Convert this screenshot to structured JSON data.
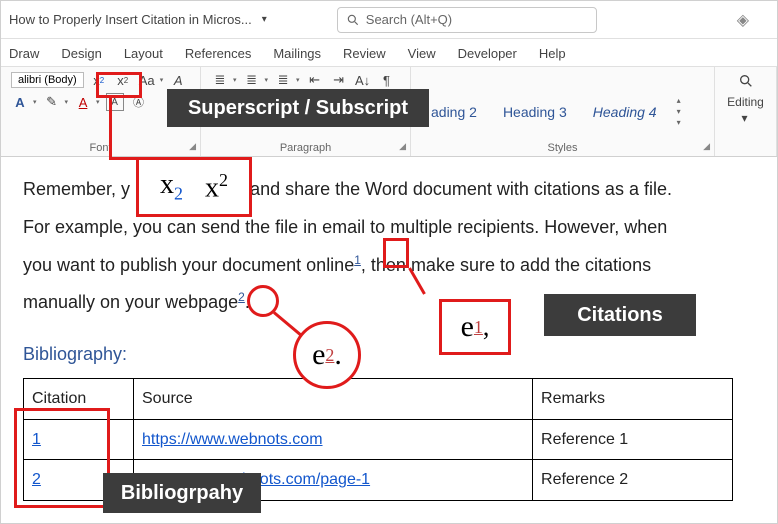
{
  "title": "How to Properly Insert Citation in Micros...",
  "search_placeholder": "Search (Alt+Q)",
  "tabs": [
    "Draw",
    "Design",
    "Layout",
    "References",
    "Mailings",
    "Review",
    "View",
    "Developer",
    "Help"
  ],
  "font_name": "alibri (Body)",
  "groups": {
    "font": "Font",
    "paragraph": "Paragraph",
    "styles": "Styles",
    "editing": "Editing"
  },
  "styles": {
    "h2": "ading 2",
    "h3": "Heading 3",
    "h4": "Heading 4"
  },
  "doc": {
    "p1a": "Remember, y",
    "p1b": "and share the Word document with citations as a file.",
    "p2a": "For example, you can send the file in email to multiple recipients. However, when",
    "p3a": "you want to publish your document onlin",
    "p3_e": "e",
    "p3_cit": "1",
    "p3b": ", then make sure to add the citations",
    "p4a": "manually on your webpage",
    "p4_cit": "2",
    "p4b": "."
  },
  "bib": {
    "heading": "Bibliography:",
    "cols": [
      "Citation",
      "Source",
      "Remarks"
    ],
    "rows": [
      {
        "n": "1",
        "src": "https://www.webnots.com",
        "rem": "Reference 1"
      },
      {
        "n": "2",
        "src": "bnots.com/page-1",
        "rem": "Reference 2"
      }
    ]
  },
  "annot": {
    "super_sub": "Superscript / Subscript",
    "citations": "Citations",
    "biblio": "Bibliogrpahy"
  },
  "zoom": {
    "x_sub": "x",
    "x_sub_s": "2",
    "x_sup": "x",
    "x_sup_s": "2",
    "e2": "e",
    "e2_s": "2",
    "e2_dot": ".",
    "e1": "e",
    "e1_s": "1",
    "e1_comma": ","
  }
}
